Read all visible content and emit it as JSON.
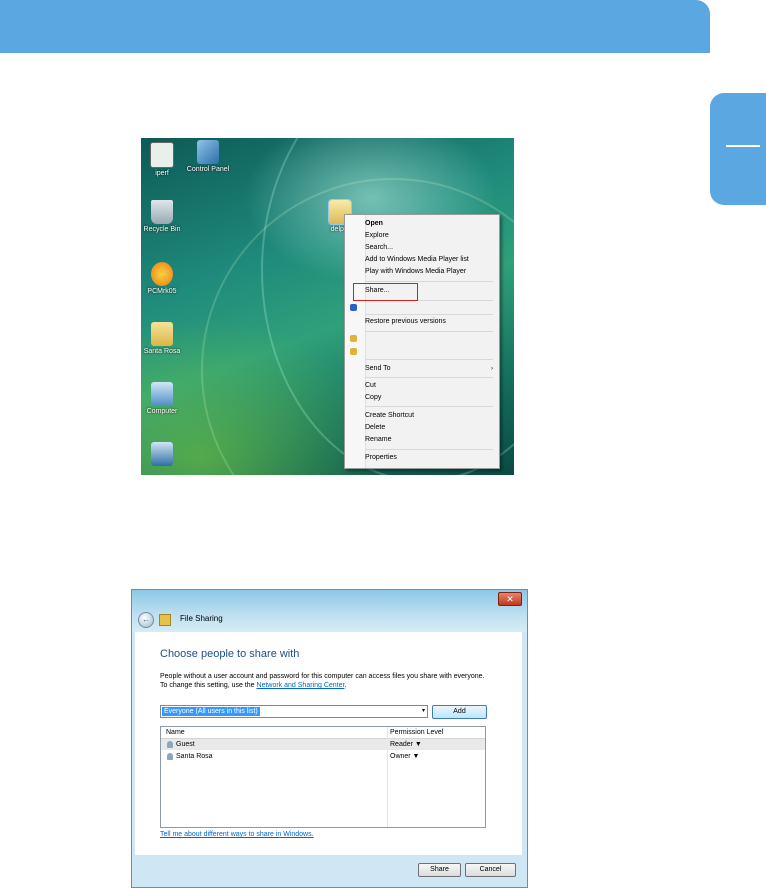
{
  "desktop": {
    "icons": [
      {
        "label": "iperf",
        "icon": "iperf-icon"
      },
      {
        "label": "Control Panel",
        "icon": "control-panel-icon"
      },
      {
        "label": "Recycle Bin",
        "icon": "recycle-bin-icon"
      },
      {
        "label": "PCMrk05",
        "icon": "pcmark-icon"
      },
      {
        "label": "Santa Rosa",
        "icon": "folder-icon"
      },
      {
        "label": "Computer",
        "icon": "computer-icon"
      },
      {
        "label": "",
        "icon": "network-icon"
      }
    ],
    "selected_folder_label": "delphi"
  },
  "context_menu": {
    "items": [
      "Open",
      "Explore",
      "Search...",
      "Add to Windows Media Player list",
      "Play with Windows Media Player",
      "Share...",
      "Restore previous versions",
      "Send To",
      "Cut",
      "Copy",
      "Create Shortcut",
      "Delete",
      "Rename",
      "Properties"
    ],
    "highlight_color": "#d42020"
  },
  "dialog": {
    "title": "File Sharing",
    "close_glyph": "✕",
    "heading": "Choose people to share with",
    "description_line1": "People without a user account and password for this computer can access files you share with everyone.",
    "description_line2_prefix": "To change this setting, use the ",
    "description_line2_link": "Network and Sharing Center",
    "description_line2_suffix": ".",
    "combo_value": "Everyone (All users in this list)",
    "add_button": "Add",
    "table": {
      "headers": [
        "Name",
        "Permission Level"
      ],
      "rows": [
        {
          "name": "Guest",
          "permission": "Reader ▼"
        },
        {
          "name": "Santa Rosa",
          "permission": "Owner ▼"
        }
      ]
    },
    "help_link": "Tell me about different ways to share in Windows.",
    "share_button": "Share",
    "cancel_button": "Cancel"
  },
  "colors": {
    "accent": "#5aa7e2",
    "link": "#0066cc",
    "heading": "#1e4e8c"
  }
}
